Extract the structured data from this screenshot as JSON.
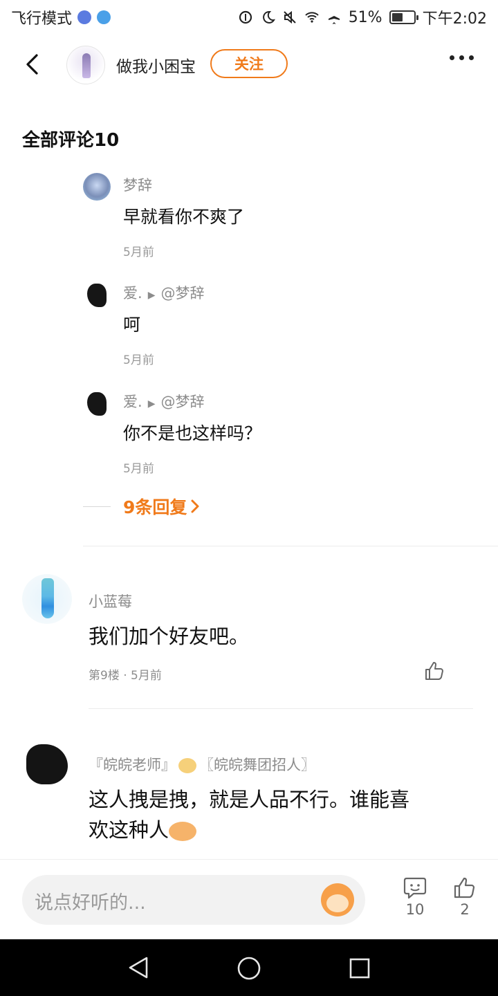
{
  "status_bar": {
    "left_text": "飞行模式",
    "battery": "51%",
    "battery_level": 0.51,
    "time": "下午2:02"
  },
  "nav": {
    "username": "做我小困宝",
    "follow_label": "关注"
  },
  "comments_title": "全部评论10",
  "replies": [
    {
      "user": "梦辞",
      "target": "",
      "text": "早就看你不爽了",
      "time": "5月前"
    },
    {
      "user": "爱.",
      "target": "@梦辞",
      "text": "呵",
      "time": "5月前"
    },
    {
      "user": "爱.",
      "target": "@梦辞",
      "text": "你不是也这样吗？",
      "time": "5月前"
    }
  ],
  "more_replies_label": "9条回复",
  "comments": [
    {
      "user": "小蓝莓",
      "text": "我们加个好友吧。",
      "floor": "第9楼",
      "time": "5月前"
    },
    {
      "user_part1": "『皖皖老师』",
      "user_part2": "〖皖皖舞团招人〗",
      "text_line1": "这人拽是拽，就是人品不行。谁能喜",
      "text_line2": "欢这种人"
    }
  ],
  "bottom_bar": {
    "placeholder": "说点好听的...",
    "comment_count": "10",
    "like_count": "2"
  },
  "colors": {
    "accent": "#f07a1a",
    "muted_text": "#8c8c8c"
  }
}
